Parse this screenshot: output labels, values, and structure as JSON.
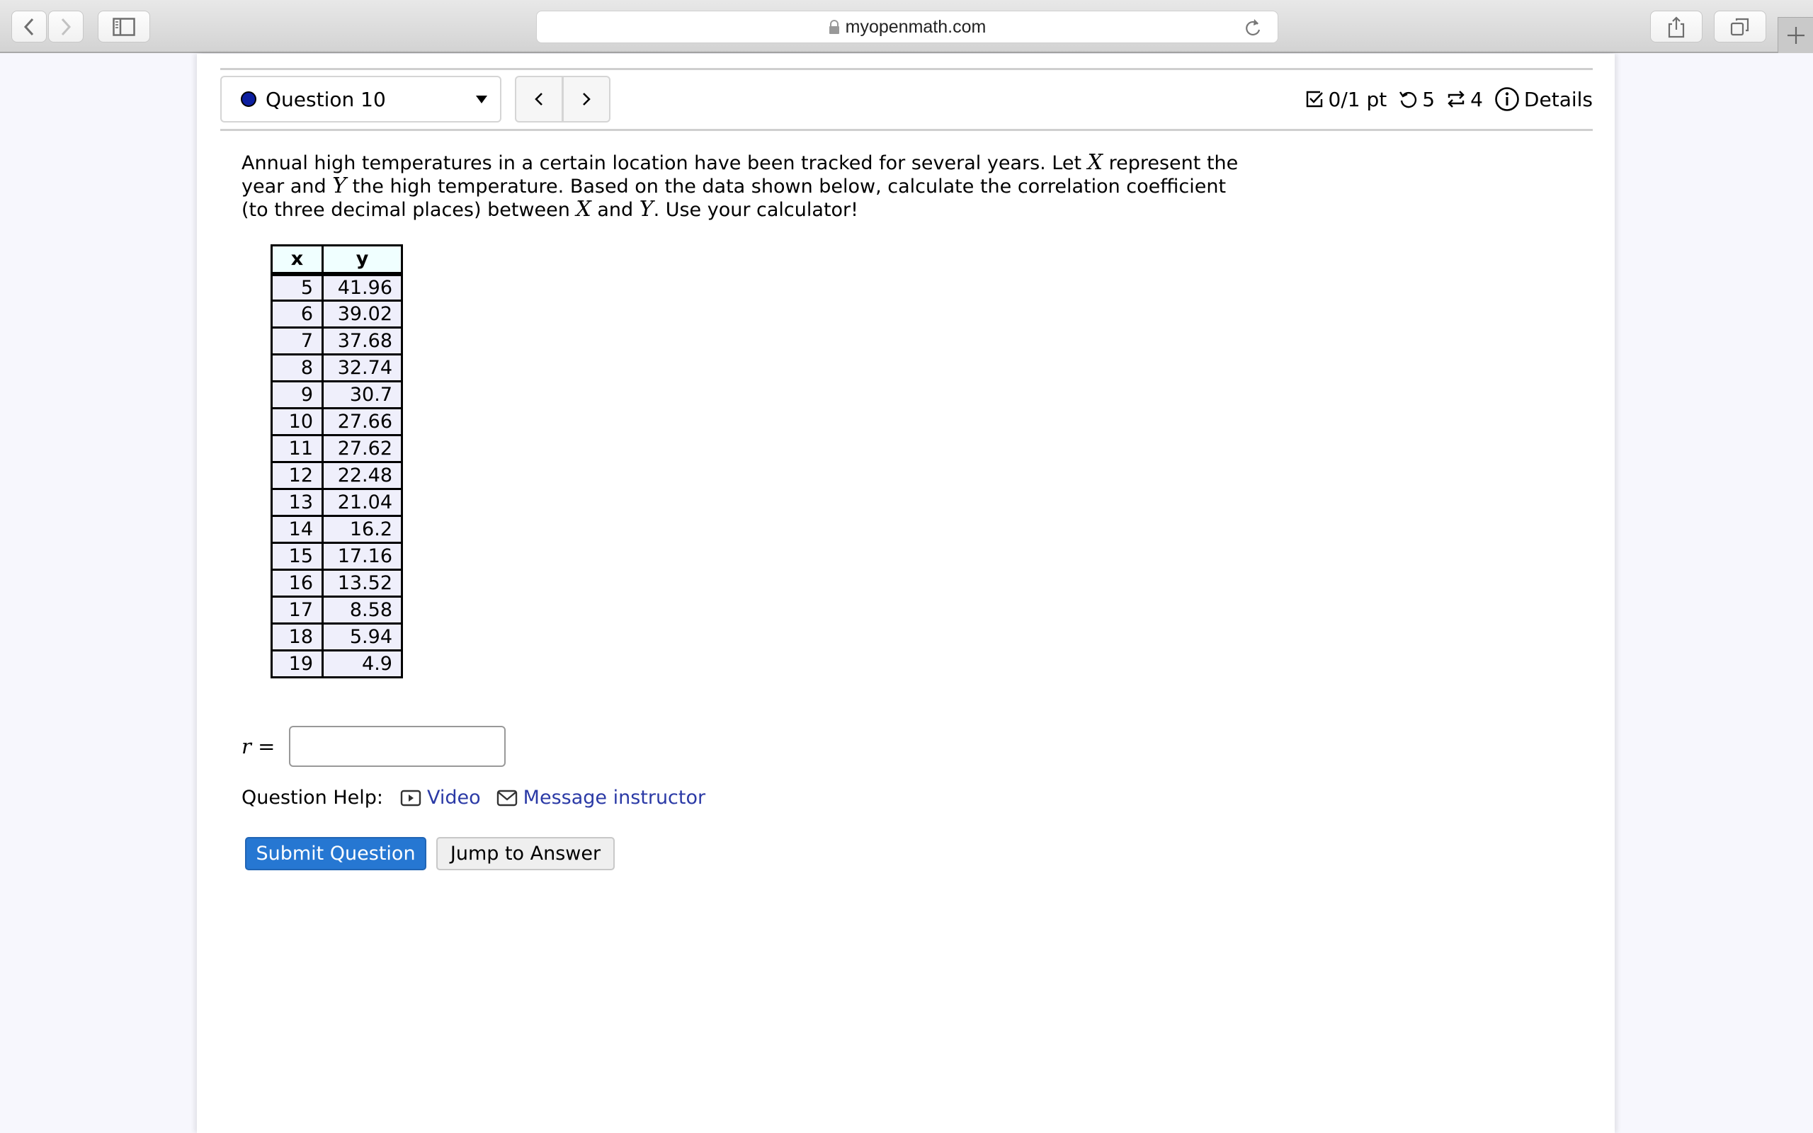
{
  "browser": {
    "url": "myopenmath.com",
    "icons": [
      "back-icon",
      "forward-icon",
      "sidebar-icon",
      "lock-icon",
      "reload-icon",
      "share-icon",
      "tabs-icon",
      "new-tab-icon"
    ]
  },
  "question_nav": {
    "selected_question": "Question 10",
    "status_color": "#0d1fa0",
    "prev_label": "<",
    "next_label": ">"
  },
  "meta": {
    "score": "0/1 pt",
    "retries": "5",
    "regenerations": "4",
    "details_label": "Details"
  },
  "question": {
    "prompt_parts": {
      "p1": "Annual high temperatures in a certain location have been tracked for several years. Let ",
      "v1": "X",
      "p2": " represent the year and ",
      "v2": "Y",
      "p3": " the high temperature. Based on the data shown below, calculate the correlation coefficient (to three decimal places) between ",
      "v3": "X",
      "p4": " and ",
      "v4": "Y",
      "p5": ". Use your calculator!"
    },
    "table": {
      "headers": [
        "x",
        "y"
      ],
      "rows": [
        [
          "5",
          "41.96"
        ],
        [
          "6",
          "39.02"
        ],
        [
          "7",
          "37.68"
        ],
        [
          "8",
          "32.74"
        ],
        [
          "9",
          "30.7"
        ],
        [
          "10",
          "27.66"
        ],
        [
          "11",
          "27.62"
        ],
        [
          "12",
          "22.48"
        ],
        [
          "13",
          "21.04"
        ],
        [
          "14",
          "16.2"
        ],
        [
          "15",
          "17.16"
        ],
        [
          "16",
          "13.52"
        ],
        [
          "17",
          "8.58"
        ],
        [
          "18",
          "5.94"
        ],
        [
          "19",
          "4.9"
        ]
      ]
    },
    "answer_label_var": "r",
    "answer_label_eq": "=",
    "answer_value": "",
    "answer_placeholder": ""
  },
  "help": {
    "label": "Question Help:",
    "video_label": "Video",
    "message_label": "Message instructor"
  },
  "actions": {
    "submit_label": "Submit Question",
    "jump_label": "Jump to Answer"
  }
}
